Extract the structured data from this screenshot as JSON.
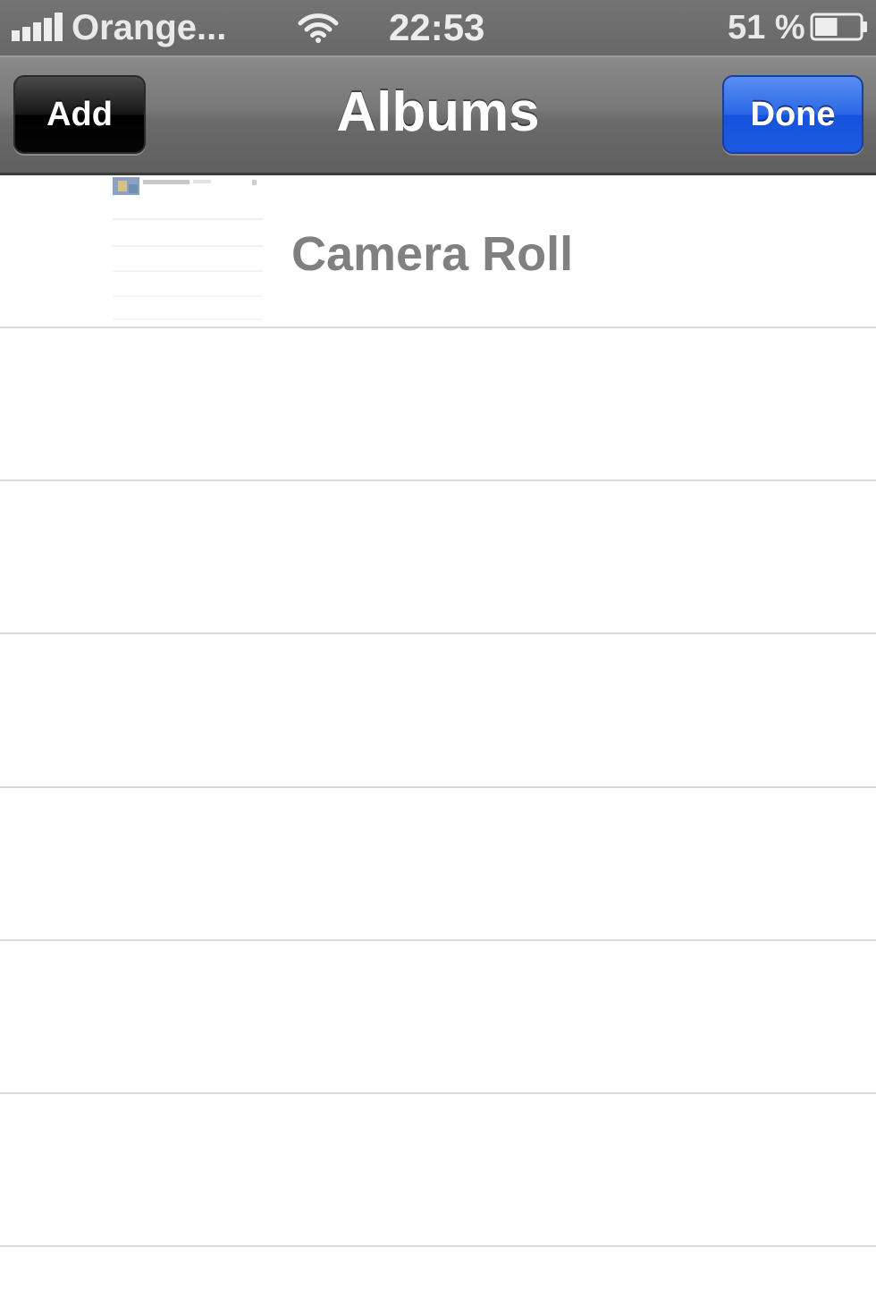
{
  "status_bar": {
    "carrier": "Orange...",
    "time": "22:53",
    "battery_percent": "51 %",
    "battery_level": 0.51,
    "signal_bars": 5,
    "icons": [
      "signal-icon",
      "wifi-icon",
      "battery-icon"
    ]
  },
  "nav": {
    "title": "Albums",
    "add_label": "Add",
    "done_label": "Done"
  },
  "albums": [
    {
      "name": "Camera Roll"
    }
  ],
  "colors": {
    "nav_bar": "#6f6f6f",
    "done_button": "#1f5ee3",
    "add_button": "#000000",
    "album_text": "#808080",
    "divider": "#dadada"
  }
}
